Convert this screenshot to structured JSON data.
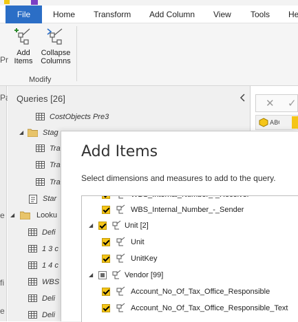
{
  "ribbon": {
    "tabs": [
      {
        "label": "File"
      },
      {
        "label": "Home"
      },
      {
        "label": "Transform"
      },
      {
        "label": "Add Column"
      },
      {
        "label": "View"
      },
      {
        "label": "Tools"
      },
      {
        "label": "He"
      }
    ],
    "buttons": [
      {
        "label": "Add\nItems",
        "icon": "add-items-icon"
      },
      {
        "label": "Collapse\nColumns",
        "icon": "collapse-columns-icon"
      }
    ],
    "group_label": "Modify"
  },
  "queries": {
    "header": "Queries [26]",
    "items": [
      {
        "label": "CostObjects Pre3",
        "icon": "table-icon"
      },
      {
        "label": "Stag",
        "icon": "folder-icon"
      },
      {
        "label": "Tra",
        "icon": "table-icon"
      },
      {
        "label": "Tra",
        "icon": "table-icon"
      },
      {
        "label": "Tra",
        "icon": "table-icon"
      },
      {
        "label": "Star",
        "icon": "query-icon"
      },
      {
        "label": "Looku",
        "icon": "folder-icon"
      },
      {
        "label": "Defi",
        "icon": "table-icon"
      },
      {
        "label": "1 3 c",
        "icon": "table-icon"
      },
      {
        "label": "1 4 c",
        "icon": "table-icon"
      },
      {
        "label": "WBS",
        "icon": "table-icon"
      },
      {
        "label": "Deli",
        "icon": "table-icon"
      },
      {
        "label": "Deli",
        "icon": "table-icon"
      }
    ],
    "left_strip_letters": [
      "Pr",
      "Pa",
      "e",
      "fi",
      "e"
    ]
  },
  "dialog": {
    "title": "Add Items",
    "subtitle": "Select dimensions and measures to add to the query.",
    "tree": [
      {
        "label": "WBS_Internal_Number_-_Receiver",
        "level": 2,
        "checked": true
      },
      {
        "label": "WBS_Internal_Number_-_Sender",
        "level": 2,
        "checked": true
      },
      {
        "label": "Unit [2]",
        "level": 1,
        "checked": true,
        "expanded": true
      },
      {
        "label": "Unit",
        "level": 2,
        "checked": true
      },
      {
        "label": "UnitKey",
        "level": 2,
        "checked": true
      },
      {
        "label": "Vendor [99]",
        "level": 1,
        "checked": "mixed",
        "expanded": true
      },
      {
        "label": "Account_No_Of_Tax_Office_Responsible",
        "level": 2,
        "checked": true
      },
      {
        "label": "Account_No_Of_Tax_Office_Responsible_Text",
        "level": 2,
        "checked": true
      }
    ]
  },
  "colors": {
    "file_tab": "#2b6ec6",
    "checkbox_yellow": "#f5c518",
    "ribbon_bg": "#f5f5f5",
    "pane_bg": "#f0f0f0"
  }
}
